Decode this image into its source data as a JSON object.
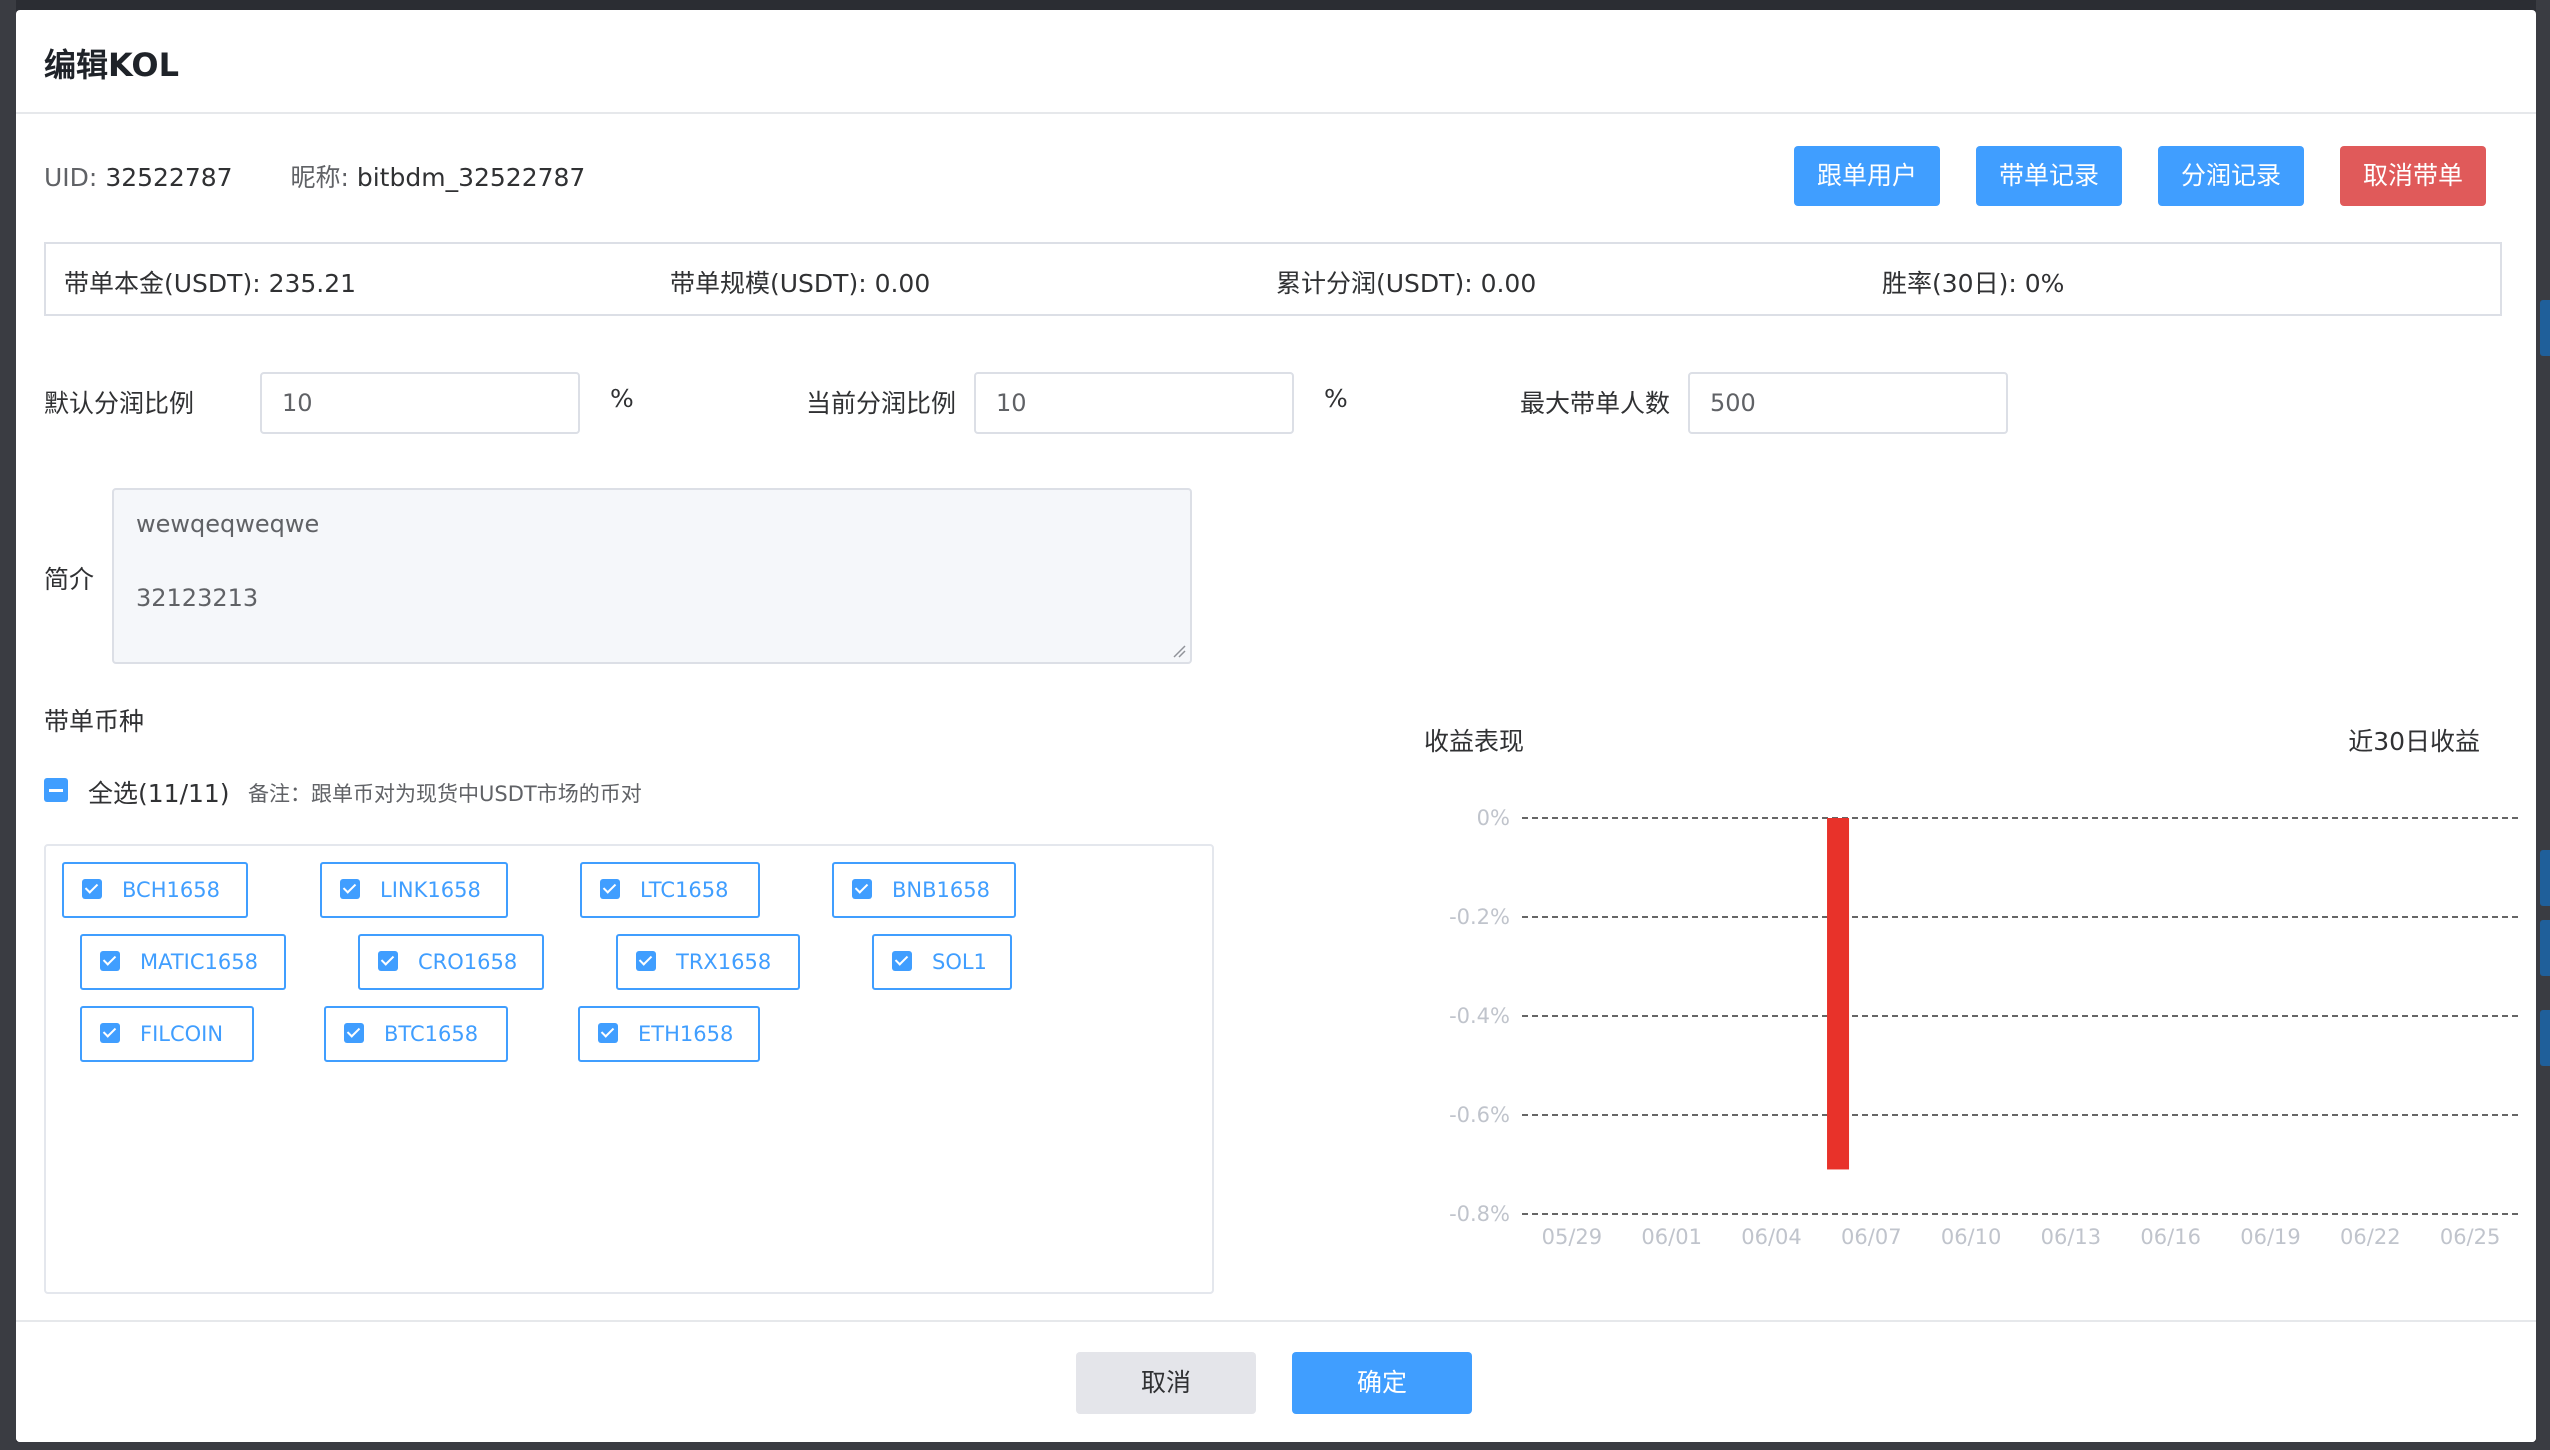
{
  "dialog": {
    "title": "编辑KOL"
  },
  "user": {
    "uid_label": "UID:",
    "uid": "32522787",
    "nickname_label": "昵称:",
    "nickname": "bitbdm_32522787"
  },
  "actions": {
    "followers": "跟单用户",
    "order_records": "带单记录",
    "profit_records": "分润记录",
    "cancel_lead": "取消带单"
  },
  "stats": {
    "principal": "带单本金(USDT): 235.21",
    "scale": "带单规模(USDT): 0.00",
    "total_profit_share": "累计分润(USDT): 0.00",
    "win_rate": "胜率(30日): 0%"
  },
  "form": {
    "default_ratio_label": "默认分润比例",
    "default_ratio_value": "10",
    "current_ratio_label": "当前分润比例",
    "current_ratio_value": "10",
    "percent": "%",
    "max_followers_label": "最大带单人数",
    "max_followers_value": "500",
    "intro_label": "简介",
    "intro_line1": "wewqeqweqwe",
    "intro_line2": "32123213"
  },
  "coins": {
    "section_label": "带单币种",
    "select_all": "全选(11/11)",
    "remark": "备注：跟单币对为现货中USDT市场的币对",
    "items": [
      "BCH1658",
      "LINK1658",
      "LTC1658",
      "BNB1658",
      "MATIC1658",
      "CRO1658",
      "TRX1658",
      "SOL1",
      "FILCOIN",
      "BTC1658",
      "ETH1658"
    ]
  },
  "chart_panel": {
    "title": "收益表现",
    "subtitle": "近30日收益"
  },
  "chart_data": {
    "type": "bar",
    "x": [
      "05/29",
      "06/01",
      "06/04",
      "06/07",
      "06/10",
      "06/13",
      "06/16",
      "06/19",
      "06/22",
      "06/25"
    ],
    "y_ticks": [
      "0%",
      "-0.2%",
      "-0.4%",
      "-0.6%",
      "-0.8%"
    ],
    "ylim": [
      -0.8,
      0
    ],
    "y_unit": "%",
    "grid": true,
    "bars": [
      {
        "x": "06/06",
        "value": -0.71,
        "color": "#e8322a"
      }
    ]
  },
  "footer": {
    "cancel": "取消",
    "confirm": "确定"
  },
  "colors": {
    "primary": "#409eff",
    "danger": "#e05a5a",
    "bar": "#e8322a"
  }
}
